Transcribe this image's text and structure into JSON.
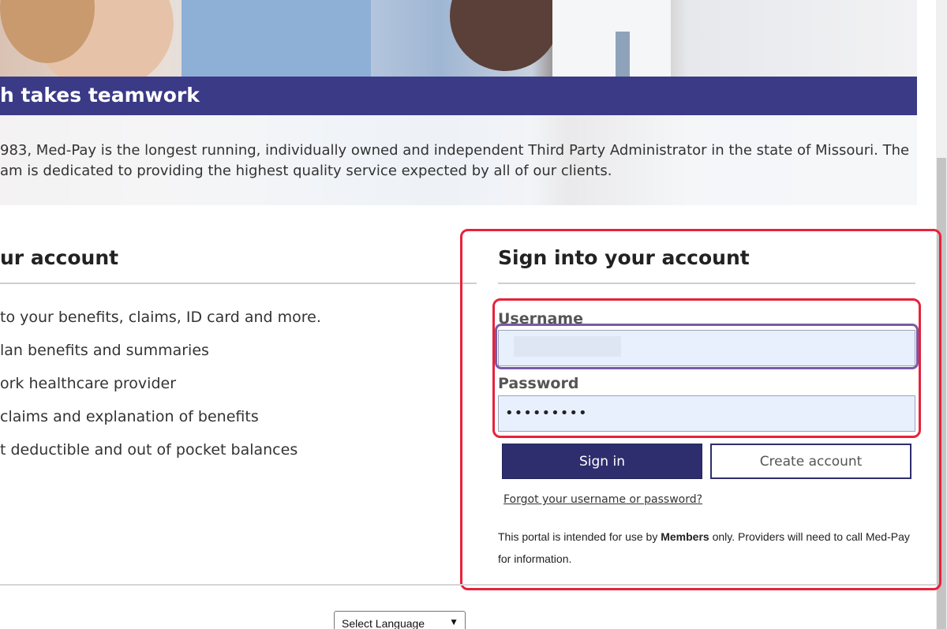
{
  "hero": {
    "headline": "h takes teamwork",
    "intro_line1": "983, Med-Pay is the longest running, individually owned and independent Third Party Administrator in the state of Missouri. The",
    "intro_line2": "am is dedicated to providing the highest quality service expected by all of our clients."
  },
  "left": {
    "title": "ur account",
    "items": [
      "to your benefits, claims, ID card and more.",
      "lan benefits and summaries",
      "ork healthcare provider",
      " claims and explanation of benefits",
      "t deductible and out of pocket balances"
    ]
  },
  "signin": {
    "title": "Sign into your account",
    "username_label": "Username",
    "username_value": "",
    "password_label": "Password",
    "password_value": "•••••••••",
    "signin_button": "Sign in",
    "create_button": "Create account",
    "forgot_link": "Forgot your username or password?",
    "notice_pre": "This portal is intended for use by ",
    "notice_bold": "Members",
    "notice_post": " only. Providers will need to call Med-Pay for information."
  },
  "footer": {
    "language_select": "Select Language"
  },
  "colors": {
    "banner": "#3b3a86",
    "primary_button": "#2e2e6e",
    "highlight_red": "#e8223b",
    "focus_purple": "#7b5aa6",
    "input_fill": "#e8f0fe"
  },
  "icons": {
    "language_dropdown": "chevron-down-icon"
  }
}
